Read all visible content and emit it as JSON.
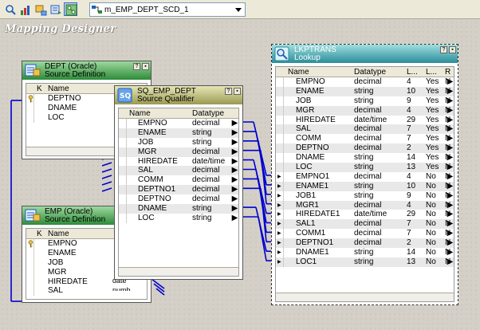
{
  "toolbar": {
    "mapping_name": "m_EMP_DEPT_SCD_1",
    "buttons": [
      "source-analyzer-icon",
      "target-designer-icon",
      "transformation-developer-icon",
      "mapplet-designer-icon",
      "mapping-designer-icon"
    ]
  },
  "canvas": {
    "title": "Mapping Designer"
  },
  "dept_source": {
    "name": "DEPT (Oracle)",
    "type": "Source Definition",
    "header_colors": [
      "#9ed89e",
      "#2e8b3a"
    ],
    "columns": {
      "key": "K",
      "name": "Name"
    },
    "rows": [
      {
        "key": true,
        "name": "DEPTNO"
      },
      {
        "key": false,
        "name": "DNAME"
      },
      {
        "key": false,
        "name": "LOC"
      }
    ]
  },
  "emp_source": {
    "name": "EMP (Oracle)",
    "type": "Source Definition",
    "header_colors": [
      "#9ed89e",
      "#2e8b3a"
    ],
    "columns": {
      "key": "K",
      "name": "Name"
    },
    "rows": [
      {
        "key": true,
        "name": "EMPNO"
      },
      {
        "key": false,
        "name": "ENAME"
      },
      {
        "key": false,
        "name": "JOB"
      },
      {
        "key": false,
        "name": "MGR"
      },
      {
        "key": false,
        "name": "HIREDATE"
      },
      {
        "key": false,
        "name": "SAL"
      }
    ]
  },
  "emp_partial": {
    "datatype": "date",
    "more": "numb"
  },
  "source_qualifier": {
    "name": "SQ_EMP_DEPT",
    "type": "Source Qualifier",
    "header_colors": [
      "#e6e6b8",
      "#9a9a52"
    ],
    "columns": {
      "name": "Name",
      "datatype": "Datatype"
    },
    "rows": [
      {
        "name": "EMPNO",
        "datatype": "decimal"
      },
      {
        "name": "ENAME",
        "datatype": "string"
      },
      {
        "name": "JOB",
        "datatype": "string"
      },
      {
        "name": "MGR",
        "datatype": "decimal"
      },
      {
        "name": "HIREDATE",
        "datatype": "date/time"
      },
      {
        "name": "SAL",
        "datatype": "decimal"
      },
      {
        "name": "COMM",
        "datatype": "decimal"
      },
      {
        "name": "DEPTNO1",
        "datatype": "decimal"
      },
      {
        "name": "DEPTNO",
        "datatype": "decimal"
      },
      {
        "name": "DNAME",
        "datatype": "string"
      },
      {
        "name": "LOC",
        "datatype": "string"
      }
    ]
  },
  "lookup": {
    "name": "LKPTRANS",
    "type": "Lookup",
    "header_colors": [
      "#9fdede",
      "#2a8c9a"
    ],
    "columns": {
      "name": "Name",
      "datatype": "Datatype",
      "length": "L...",
      "lookup": "L...",
      "return": "R"
    },
    "rows": [
      {
        "name": "EMPNO",
        "datatype": "decimal",
        "length": "4",
        "lookup": "Yes",
        "return": "N"
      },
      {
        "name": "ENAME",
        "datatype": "string",
        "length": "10",
        "lookup": "Yes",
        "return": "N"
      },
      {
        "name": "JOB",
        "datatype": "string",
        "length": "9",
        "lookup": "Yes",
        "return": "N"
      },
      {
        "name": "MGR",
        "datatype": "decimal",
        "length": "4",
        "lookup": "Yes",
        "return": "N"
      },
      {
        "name": "HIREDATE",
        "datatype": "date/time",
        "length": "29",
        "lookup": "Yes",
        "return": "N"
      },
      {
        "name": "SAL",
        "datatype": "decimal",
        "length": "7",
        "lookup": "Yes",
        "return": "N"
      },
      {
        "name": "COMM",
        "datatype": "decimal",
        "length": "7",
        "lookup": "Yes",
        "return": "N"
      },
      {
        "name": "DEPTNO",
        "datatype": "decimal",
        "length": "2",
        "lookup": "Yes",
        "return": "N"
      },
      {
        "name": "DNAME",
        "datatype": "string",
        "length": "14",
        "lookup": "Yes",
        "return": "N"
      },
      {
        "name": "LOC",
        "datatype": "string",
        "length": "13",
        "lookup": "Yes",
        "return": "N"
      },
      {
        "name": "EMPNO1",
        "datatype": "decimal",
        "length": "4",
        "lookup": "No",
        "return": "N"
      },
      {
        "name": "ENAME1",
        "datatype": "string",
        "length": "10",
        "lookup": "No",
        "return": "N"
      },
      {
        "name": "JOB1",
        "datatype": "string",
        "length": "9",
        "lookup": "No",
        "return": "N"
      },
      {
        "name": "MGR1",
        "datatype": "decimal",
        "length": "4",
        "lookup": "No",
        "return": "N"
      },
      {
        "name": "HIREDATE1",
        "datatype": "date/time",
        "length": "29",
        "lookup": "No",
        "return": "N"
      },
      {
        "name": "SAL1",
        "datatype": "decimal",
        "length": "7",
        "lookup": "No",
        "return": "N"
      },
      {
        "name": "COMM1",
        "datatype": "decimal",
        "length": "7",
        "lookup": "No",
        "return": "N"
      },
      {
        "name": "DEPTNO1",
        "datatype": "decimal",
        "length": "2",
        "lookup": "No",
        "return": "N"
      },
      {
        "name": "DNAME1",
        "datatype": "string",
        "length": "14",
        "lookup": "No",
        "return": "N"
      },
      {
        "name": "LOC1",
        "datatype": "string",
        "length": "13",
        "lookup": "No",
        "return": "N"
      }
    ]
  },
  "colors": {
    "link": "#0000cc",
    "selected_row": "#e8e8e8"
  }
}
